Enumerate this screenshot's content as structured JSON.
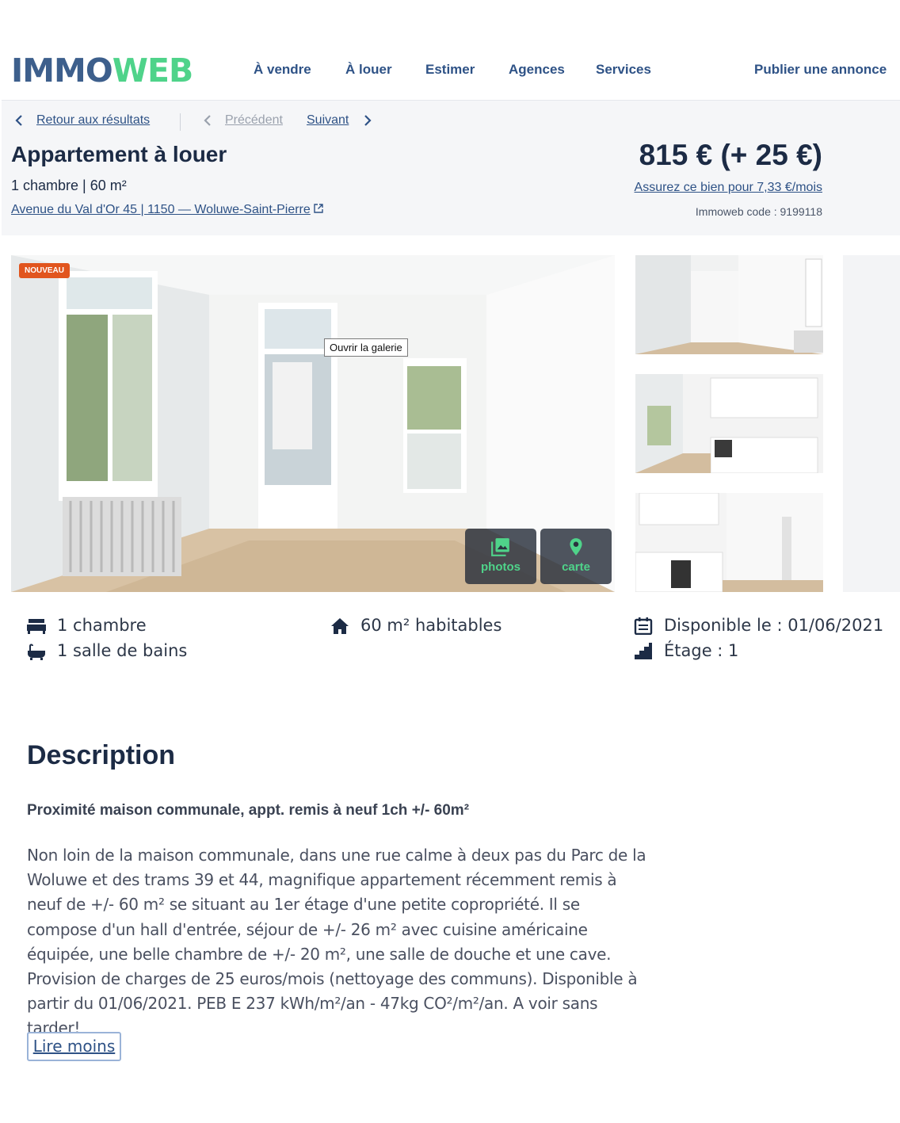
{
  "brand": {
    "part1": "IMMO",
    "part2": "WEB"
  },
  "nav": [
    "À vendre",
    "À louer",
    "Estimer",
    "Agences",
    "Services",
    "Publier une annonce"
  ],
  "breadcrumbs": {
    "back": "Retour aux résultats",
    "previous": "Précédent",
    "next": "Suivant"
  },
  "listing": {
    "title": "Appartement à louer",
    "summary": "1 chambre | 60 m²",
    "address": "Avenue du Val d'Or 45 | 1150 — Woluwe-Saint-Pierre",
    "price": "815 € (+ 25 €)",
    "insurance": "Assurez ce bien pour 7,33 €/mois",
    "code": "Immoweb code : 9199118"
  },
  "gallery": {
    "badge": "NOUVEAU",
    "tooltip": "Ouvrir la galerie",
    "photos_label": "photos",
    "map_label": "carte"
  },
  "features": {
    "bedrooms": "1 chambre",
    "bathrooms": "1 salle de bains",
    "surface": "60 m² habitables",
    "available": "Disponible le : 01/06/2021",
    "floor": "Étage : 1"
  },
  "description": {
    "heading": "Description",
    "subtitle": "Proximité maison communale, appt. remis à neuf 1ch +/- 60m²",
    "body": "Non loin de la maison communale, dans une rue calme à deux pas du Parc de la Woluwe et des trams 39 et 44, magnifique appartement récemment remis à neuf de +/- 60 m² se situant au 1er étage d'une petite copropriété. Il se compose d'un hall d'entrée, séjour de +/- 26 m² avec cuisine américaine équipée, une belle chambre de +/- 20 m², une salle de douche et une cave. Provision de charges de 25 euros/mois (nettoyage des communs). Disponible à partir du 01/06/2021. PEB E 237 kWh/m²/an - 47kg CO²/m²/an. A voir sans tarder!",
    "read_less": "Lire moins"
  },
  "colors": {
    "brand_blue": "#3d5f8c",
    "brand_green": "#4fd38a",
    "badge": "#e1551e"
  }
}
